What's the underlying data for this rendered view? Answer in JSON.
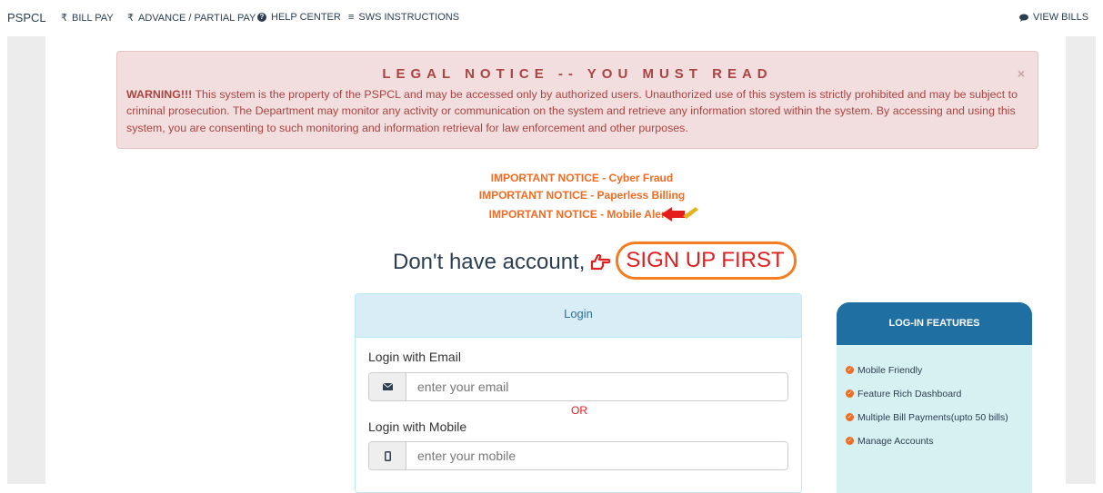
{
  "nav": {
    "brand": "PSPCL",
    "items": [
      {
        "label": "BILL PAY",
        "icon": "rupee-icon"
      },
      {
        "label": "ADVANCE / PARTIAL PAY",
        "icon": "rupee-icon"
      },
      {
        "label": "HELP CENTER",
        "icon": "help-icon"
      },
      {
        "label": "SWS INSTRUCTIONS",
        "icon": "list-icon"
      }
    ],
    "right": {
      "label": "VIEW BILLS",
      "icon": "chat-icon"
    }
  },
  "alert": {
    "title": "LEGAL NOTICE -- YOU MUST READ",
    "close": "×",
    "warning": "WARNING!!!",
    "body": " This system is the property of the PSPCL and may be accessed only by authorized users. Unauthorized use of this system is strictly prohibited and may be subject to criminal prosecution. The Department may monitor any activity or communication on the system and retrieve any information stored within the system. By accessing and using this system, you are consenting to such monitoring and information retrieval for law enforcement and other purposes."
  },
  "notices": [
    "IMPORTANT NOTICE - Cyber Fraud",
    "IMPORTANT NOTICE - Paperless Billing",
    "IMPORTANT NOTICE - Mobile Alerts"
  ],
  "signup": {
    "prefix": "Don't have account,",
    "link": "SIGN UP FIRST"
  },
  "login": {
    "title": "Login",
    "email_label": "Login with Email",
    "email_placeholder": "enter your email",
    "or": "OR",
    "mobile_label": "Login with Mobile",
    "mobile_placeholder": "enter your mobile"
  },
  "features": {
    "title": "LOG-IN FEATURES",
    "items": [
      "Mobile Friendly",
      "Feature Rich Dashboard",
      "Multiple Bill Payments(upto 50 bills)",
      "Manage Accounts"
    ]
  },
  "colors": {
    "accent_orange": "#f26b21",
    "alert_text": "#a94442",
    "features_head": "#1f6fa3"
  }
}
